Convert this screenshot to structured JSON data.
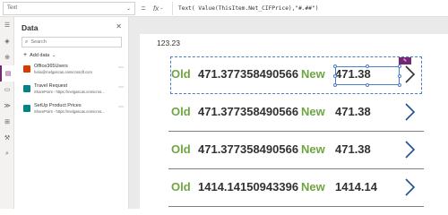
{
  "formula_bar": {
    "property": "Text",
    "equals": "=",
    "fx": "fx",
    "formula": "Text( Value(ThisItem.Net_CIFPrice),\"#.##\")"
  },
  "rail": {
    "icons": [
      "menu-icon",
      "layers-icon",
      "plus-icon",
      "database-icon",
      "media-icon",
      "flow-icon",
      "variables-icon",
      "tools-icon",
      "search-icon"
    ]
  },
  "data_pane": {
    "title": "Data",
    "close": "✕",
    "search_placeholder": "Search",
    "add_data_label": "Add data",
    "sources": [
      {
        "name": "Office365Users",
        "sub": "helia@melgascas.onmicrosoft.com",
        "color": "#d83b01"
      },
      {
        "name": "Travel Request",
        "sub": "SharePoint - https://melgascas.onmicros...",
        "color": "#038387"
      },
      {
        "name": "SetUp Product Prices",
        "sub": "SharePoint - https://melgascas.onmicros...",
        "color": "#038387"
      }
    ]
  },
  "canvas": {
    "top_label": "123.23",
    "rows": [
      {
        "old_label": "Old",
        "old_value": "471.377358490566",
        "new_label": "New",
        "new_value": "471.38"
      },
      {
        "old_label": "Old",
        "old_value": "471.377358490566",
        "new_label": "New",
        "new_value": "471.38"
      },
      {
        "old_label": "Old",
        "old_value": "471.377358490566",
        "new_label": "New",
        "new_value": "471.38"
      },
      {
        "old_label": "Old",
        "old_value": "1414.14150943396",
        "new_label": "New",
        "new_value": "1414.14"
      }
    ],
    "edit_badge": "✎"
  },
  "colors": {
    "accent": "#742774",
    "label_green": "#6fa543",
    "selection": "#4a7fcb",
    "arrow": "#1f4e9a"
  }
}
